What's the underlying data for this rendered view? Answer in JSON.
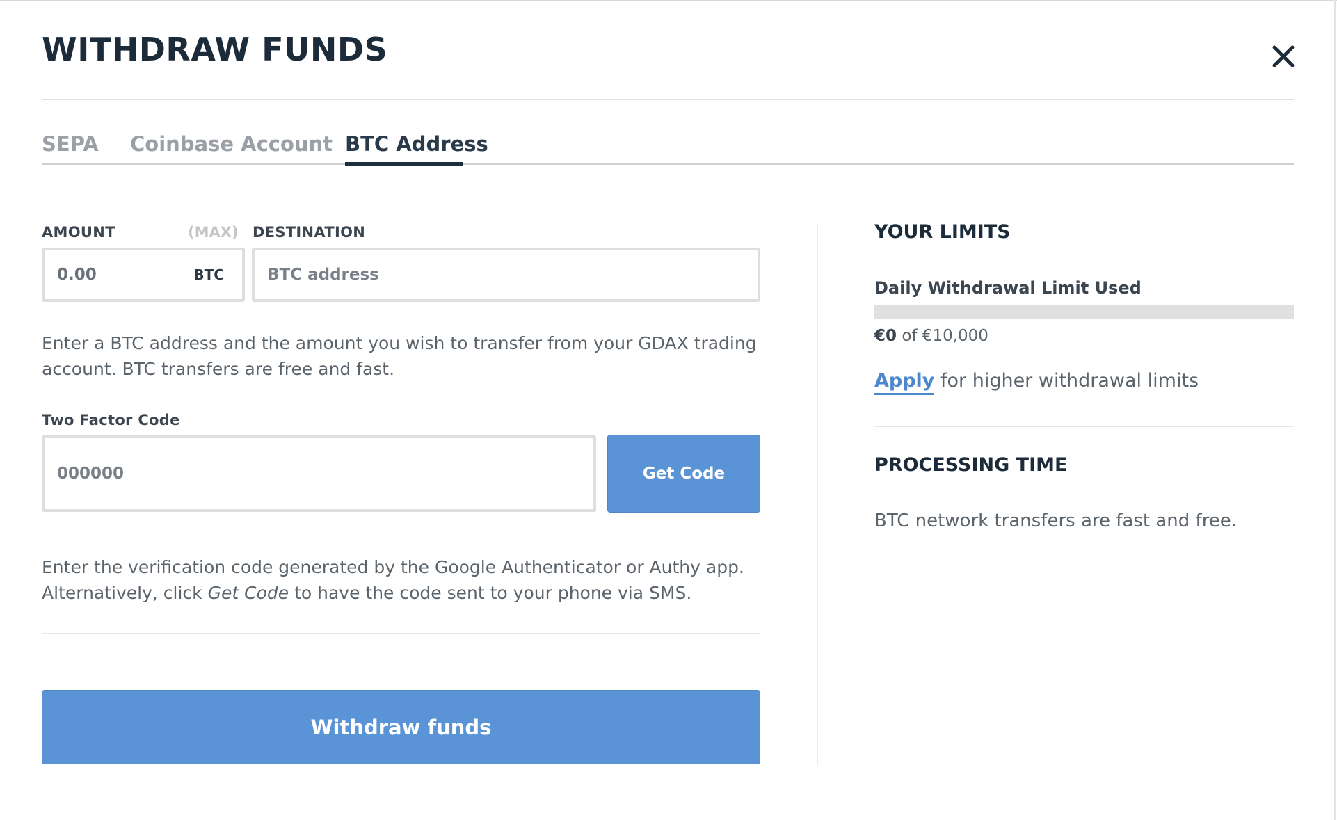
{
  "modal": {
    "title": "WITHDRAW FUNDS",
    "close_icon": "close-icon"
  },
  "tabs": [
    {
      "label": "SEPA",
      "active": false
    },
    {
      "label": "Coinbase Account",
      "active": false
    },
    {
      "label": "BTC Address",
      "active": true
    }
  ],
  "form": {
    "amount_label": "AMOUNT",
    "max_label": "(MAX)",
    "amount_value": "0.00",
    "amount_unit": "BTC",
    "destination_label": "DESTINATION",
    "destination_placeholder": "BTC address",
    "transfer_help": "Enter a BTC address and the amount you wish to transfer from your GDAX trading account. BTC transfers are free and fast.",
    "two_factor_label": "Two Factor Code",
    "two_factor_placeholder": "000000",
    "get_code_label": "Get Code",
    "verify_help_part1": "Enter the verification code generated by the Google Authenticator or Authy app. Alternatively, click",
    "verify_help_emphasis": "Get Code",
    "verify_help_part2": "to have the code sent to your phone via SMS.",
    "submit_label": "Withdraw funds"
  },
  "sidebar": {
    "limits_heading": "YOUR LIMITS",
    "daily_limit_label": "Daily Withdrawal Limit Used",
    "daily_limit_used_fraction": 0,
    "used_amount": "€0",
    "of_text": "of €10,000",
    "apply_link": "Apply",
    "apply_text": "for higher withdrawal limits",
    "processing_heading": "PROCESSING TIME",
    "processing_text": "BTC network transfers are fast and free."
  },
  "colors": {
    "accent": "#5b94d6",
    "text_dark": "#1c2b3a",
    "text_muted": "#5b636b"
  }
}
